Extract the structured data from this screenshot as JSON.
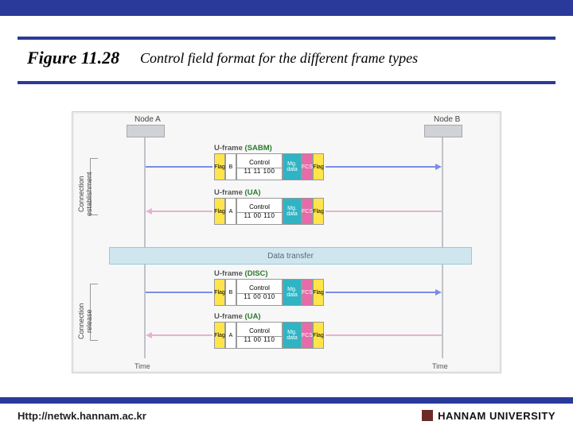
{
  "figure": {
    "number": "Figure 11.28",
    "caption": "Control field format for the different frame types"
  },
  "footer": {
    "url": "Http://netwk.hannam.ac.kr",
    "university": "HANNAM  UNIVERSITY"
  },
  "diagram": {
    "nodeA": "Node A",
    "nodeB": "Node B",
    "timeA": "Time",
    "timeB": "Time",
    "side_establish": "Connection establishment",
    "side_release": "Connection release",
    "data_transfer": "Data transfer",
    "frames": [
      {
        "label_prefix": "U-frame",
        "label_tag": "(SABM)",
        "addr": "B",
        "control_title": "Control",
        "control_bits": "11 11   100",
        "mg": "Mg. data",
        "fcs": "FCS",
        "flag": "Flag",
        "direction": "right"
      },
      {
        "label_prefix": "U-frame",
        "label_tag": "(UA)",
        "addr": "A",
        "control_title": "Control",
        "control_bits": "11 00   110",
        "mg": "Mg. data",
        "fcs": "FCS",
        "flag": "Flag",
        "direction": "left"
      },
      {
        "label_prefix": "U-frame",
        "label_tag": "(DISC)",
        "addr": "B",
        "control_title": "Control",
        "control_bits": "11 00   010",
        "mg": "Mg. data",
        "fcs": "FCS",
        "flag": "Flag",
        "direction": "right"
      },
      {
        "label_prefix": "U-frame",
        "label_tag": "(UA)",
        "addr": "A",
        "control_title": "Control",
        "control_bits": "11 00   110",
        "mg": "Mg. data",
        "fcs": "FCS",
        "flag": "Flag",
        "direction": "left"
      }
    ]
  }
}
